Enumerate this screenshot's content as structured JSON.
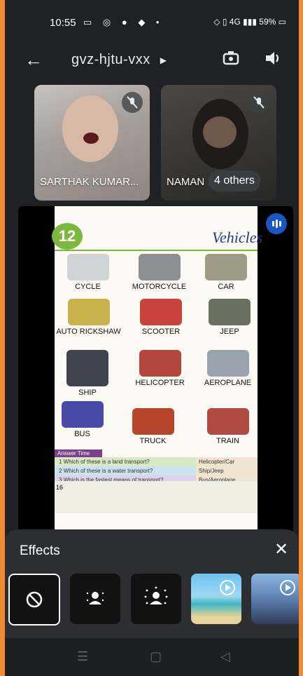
{
  "status_bar": {
    "time": "10:55",
    "battery": "59%",
    "net_badge": "4G"
  },
  "header": {
    "meeting_code": "gvz-hjtu-vxx",
    "icons": [
      "back-arrow-icon",
      "caret-right-icon",
      "switch-camera-icon",
      "speaker-icon"
    ]
  },
  "participants": [
    {
      "name": "SARTHAK KUMAR...",
      "muted": true
    },
    {
      "name": "NAMAN",
      "muted": true
    }
  ],
  "others_label": "4 others",
  "presentation": {
    "chapter_number": "12",
    "chapter_title": "Vehicles",
    "vehicles": [
      "CYCLE",
      "MOTORCYCLE",
      "CAR",
      "AUTO RICKSHAW",
      "SCOOTER",
      "JEEP",
      "SHIP",
      "HELICOPTER",
      "AEROPLANE",
      "BUS",
      "TRUCK",
      "TRAIN"
    ],
    "answer_time_label": "Answer Time",
    "questions": [
      {
        "n": "1",
        "q": "Which of these is a land transport?",
        "a": "Helicopter/Car"
      },
      {
        "n": "2",
        "q": "Which of these is a water transport?",
        "a": "Ship/Jeep"
      },
      {
        "n": "3",
        "q": "Which is the fastest means of transport?",
        "a": "Bus/Aeroplane"
      }
    ],
    "page_number": "16"
  },
  "effects": {
    "title": "Effects",
    "items": [
      {
        "name": "no-effect",
        "selected": true
      },
      {
        "name": "slight-blur",
        "selected": false
      },
      {
        "name": "blur",
        "selected": false
      },
      {
        "name": "beach-background",
        "selected": false
      },
      {
        "name": "car-background",
        "selected": false
      }
    ]
  },
  "colors": {
    "frame": "#f28b30",
    "background": "#202124",
    "panel": "#2d2e31",
    "accent_blue": "#1a56c4"
  }
}
